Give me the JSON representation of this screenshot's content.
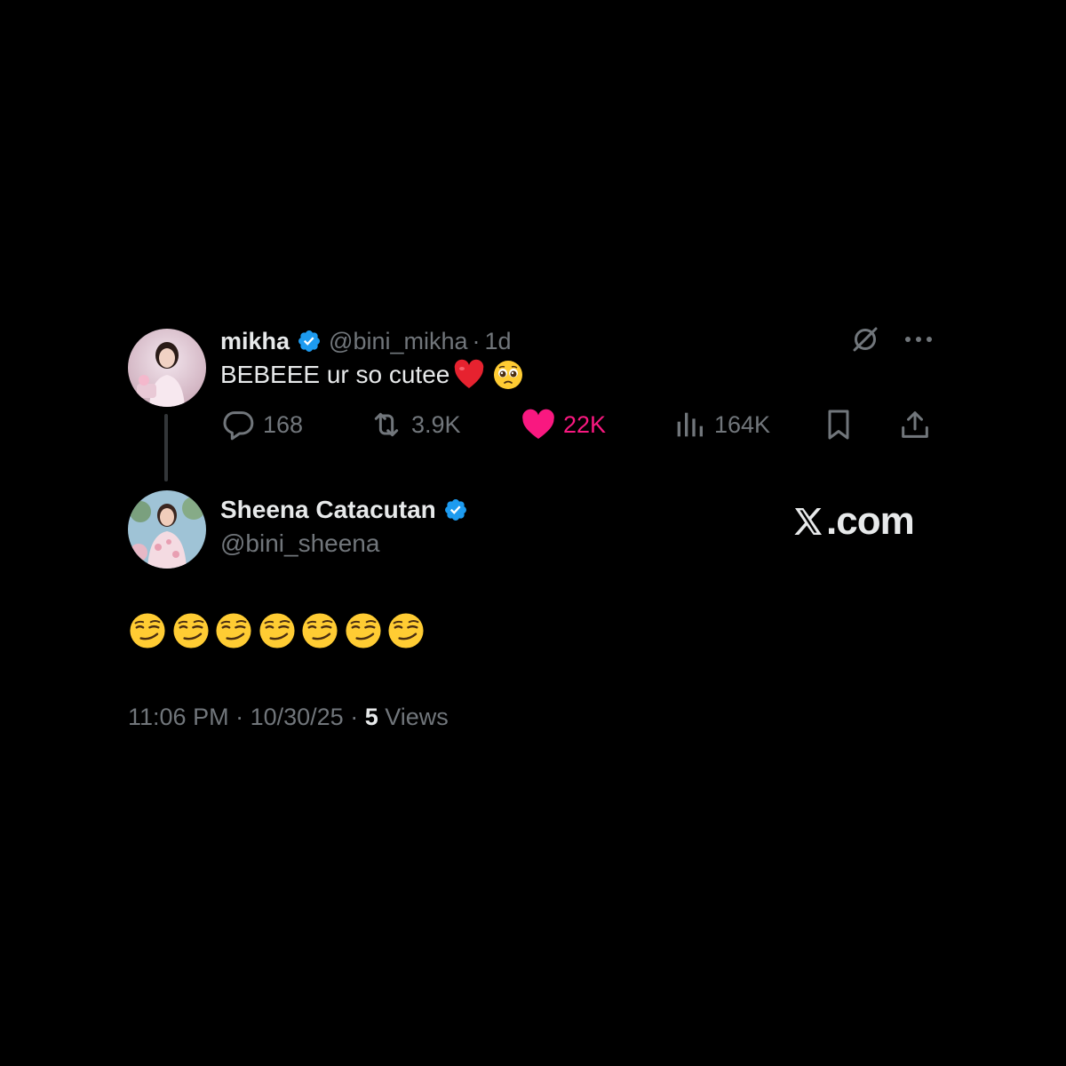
{
  "quoted_tweet": {
    "author_name": "mikha",
    "handle": "@bini_mikha",
    "separator": "·",
    "age": "1d",
    "text": "BEBEEE ur so cutee",
    "emojis": [
      "red-heart",
      "pleading-face"
    ],
    "icons": [
      "grok-icon",
      "more-icon"
    ],
    "actions": {
      "reply_count": "168",
      "repost_count": "3.9K",
      "like_count": "22K",
      "views_count": "164K"
    },
    "liked": true
  },
  "reply_tweet": {
    "author_name": "Sheena Catacutan",
    "handle": "@bini_sheena",
    "text_emoji": "smirking-face",
    "emoji_count": 7,
    "time": "11:06 PM",
    "date": "10/30/25",
    "sep": " · ",
    "views_count": "5",
    "views_label": "Views"
  },
  "watermark": {
    "text": ".com",
    "logo": "x-logo"
  },
  "colors": {
    "background": "#000000",
    "text_primary": "#e7e9ea",
    "text_secondary": "#71767b",
    "verified": "#1d9bf0",
    "like": "#f91880",
    "thread_line": "#333639"
  }
}
